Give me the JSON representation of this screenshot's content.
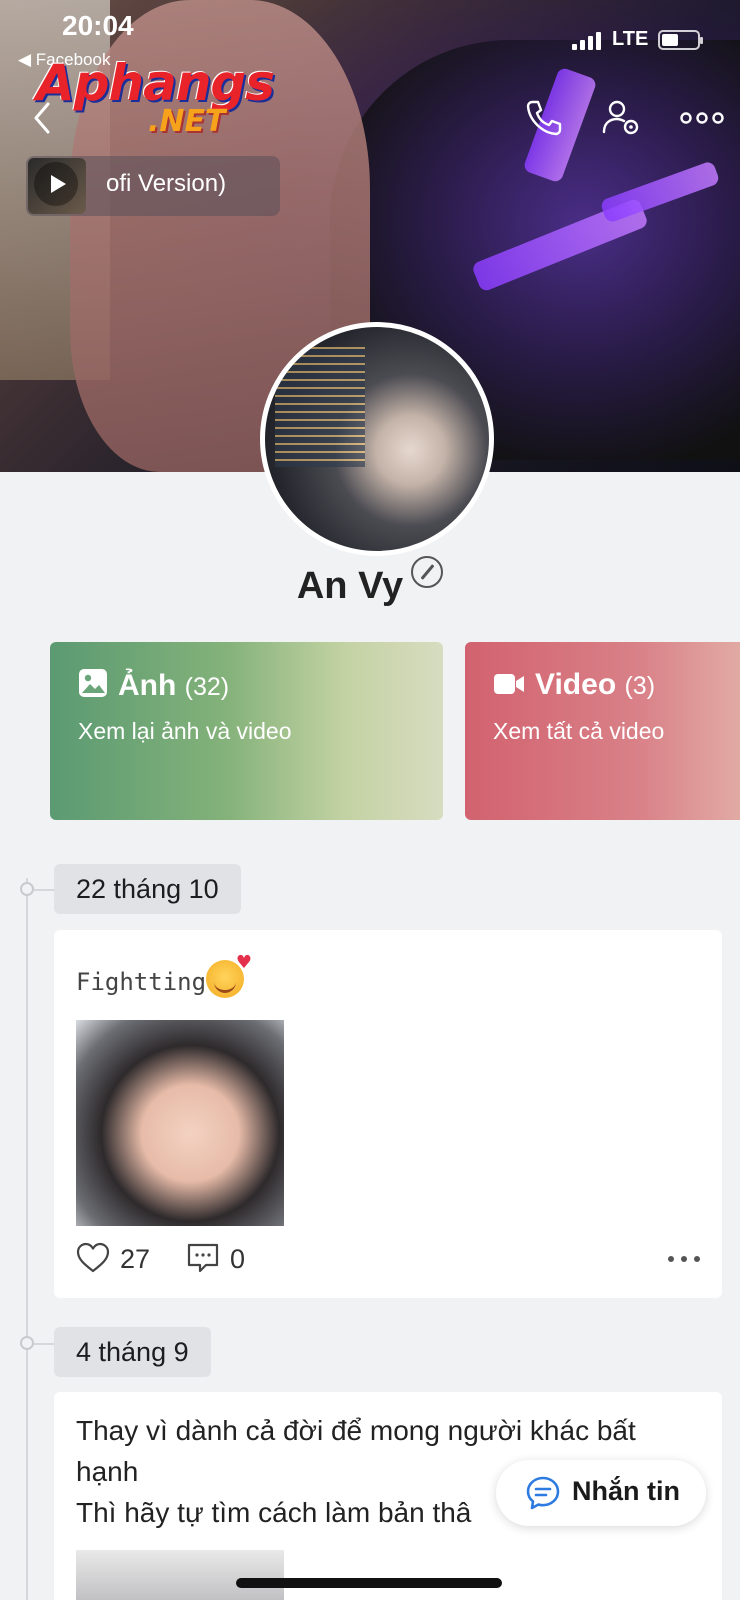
{
  "status_bar": {
    "time": "20:04",
    "back_app": "◀ Facebook",
    "network": "LTE"
  },
  "watermark": {
    "line1": "Aphangs",
    "line2": ".NET"
  },
  "music": {
    "title": "ofi Version)"
  },
  "profile": {
    "name": "An Vy"
  },
  "media": {
    "photos": {
      "label": "Ảnh",
      "count": "(32)",
      "subtitle": "Xem lại ảnh và video"
    },
    "videos": {
      "label": "Video",
      "count": "(3)",
      "subtitle": "Xem tất cả video"
    }
  },
  "timeline": [
    {
      "date": "22 tháng 10",
      "caption": "Fightting",
      "likes": "27",
      "comments": "0"
    },
    {
      "date": "4 tháng 9",
      "line1": "Thay vì dành cả đời để mong người khác bất hạnh",
      "line2": "Thì hãy tự tìm cách làm bản thâ"
    }
  ],
  "message_button": {
    "label": "Nhắn tin"
  },
  "colors": {
    "photo_card": "#6aa57a",
    "video_card": "#d6707b",
    "chat_blue": "#2d7be0"
  }
}
